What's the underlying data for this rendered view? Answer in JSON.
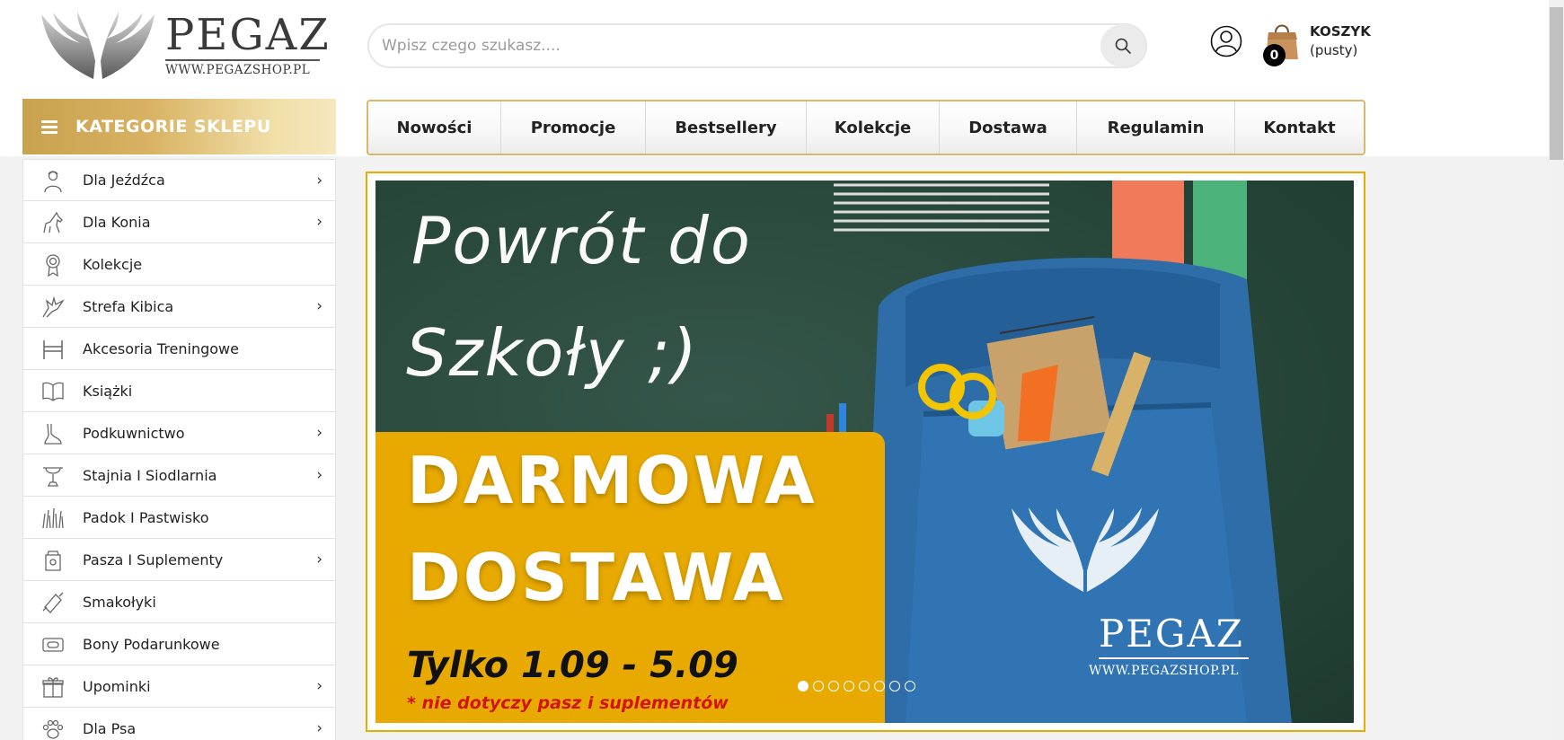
{
  "logo": {
    "wordmark": "PEGAZ",
    "url_text": "WWW.PEGAZSHOP.PL"
  },
  "search": {
    "placeholder": "Wpisz czego szukasz...."
  },
  "cart": {
    "label": "KOSZYK",
    "status": "(pusty)",
    "count": "0"
  },
  "categories": {
    "header": "KATEGORIE SKLEPU",
    "items": [
      {
        "label": "Dla Jeźdźca",
        "icon": "rider-icon",
        "has_children": true
      },
      {
        "label": "Dla Konia",
        "icon": "horse-icon",
        "has_children": true
      },
      {
        "label": "Kolekcje",
        "icon": "rosette-icon",
        "has_children": false
      },
      {
        "label": "Strefa Kibica",
        "icon": "pegasus-icon",
        "has_children": true
      },
      {
        "label": "Akcesoria Treningowe",
        "icon": "jump-hurdle-icon",
        "has_children": false
      },
      {
        "label": "Książki",
        "icon": "book-icon",
        "has_children": false
      },
      {
        "label": "Podkuwnictwo",
        "icon": "hoof-icon",
        "has_children": true
      },
      {
        "label": "Stajnia I Siodlarnia",
        "icon": "trophy-icon",
        "has_children": true
      },
      {
        "label": "Padok I Pastwisko",
        "icon": "grass-icon",
        "has_children": false
      },
      {
        "label": "Pasza I Suplementy",
        "icon": "feed-bucket-icon",
        "has_children": true
      },
      {
        "label": "Smakołyki",
        "icon": "treat-icon",
        "has_children": false
      },
      {
        "label": "Bony Podarunkowe",
        "icon": "voucher-icon",
        "has_children": false
      },
      {
        "label": "Upominki",
        "icon": "gift-icon",
        "has_children": true
      },
      {
        "label": "Dla Psa",
        "icon": "paw-icon",
        "has_children": true
      }
    ]
  },
  "nav": {
    "items": [
      "Nowości",
      "Promocje",
      "Bestsellery",
      "Kolekcje",
      "Dostawa",
      "Regulamin",
      "Kontakt"
    ]
  },
  "banner": {
    "line1": "Powrót do",
    "line2": "Szkoły ;)",
    "promo_line1": "DARMOWA",
    "promo_line2": "DOSTAWA",
    "dates": "Tylko 1.09 - 5.09",
    "note": "* nie dotyczy pasz i suplementów",
    "bag_logo_word": "PEGAZ",
    "bag_logo_url": "WWW.PEGAZSHOP.PL",
    "slides_total": 8,
    "active_slide": 1
  },
  "colors": {
    "gold": "#d9b869",
    "promo_yellow": "#e8aa00",
    "note_red": "#d11414"
  }
}
